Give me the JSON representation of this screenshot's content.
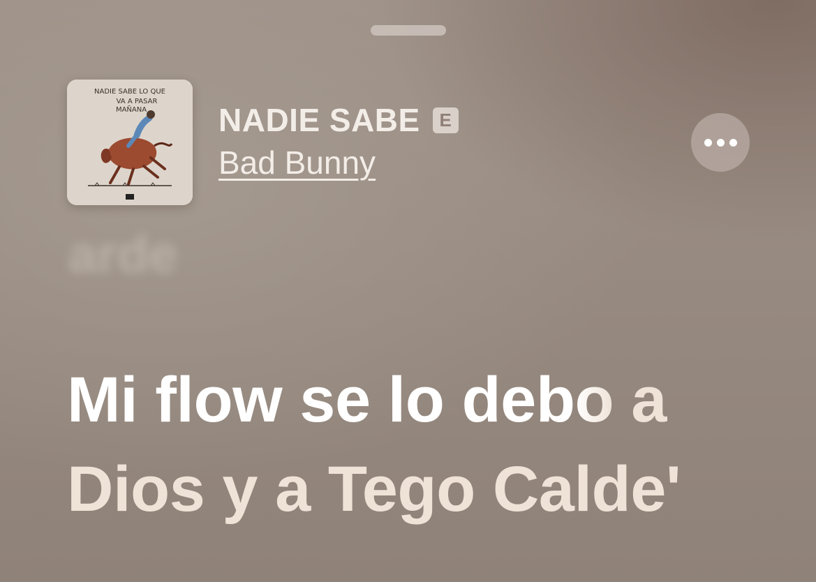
{
  "grabber": {
    "label": ""
  },
  "now_playing": {
    "album_artwork": {
      "title_lines": [
        "NADIE SABE LO QUE",
        "VA A PASAR",
        "MAÑANA"
      ]
    },
    "title": "NADIE SABE",
    "explicit_badge": "E",
    "artist": "Bad Bunny",
    "more_icon": "ellipsis-icon"
  },
  "lyrics": {
    "previous_line": "arde",
    "current_line": {
      "line1_sung": "Mi flow se lo deb",
      "line1_transition": "o",
      "line1_unsung": " a",
      "line2": "Dios y a Tego Calde'"
    }
  },
  "colors": {
    "background": "#978a80",
    "sung_lyric": "#ffffff",
    "unsung_lyric": "#efe2d7"
  }
}
